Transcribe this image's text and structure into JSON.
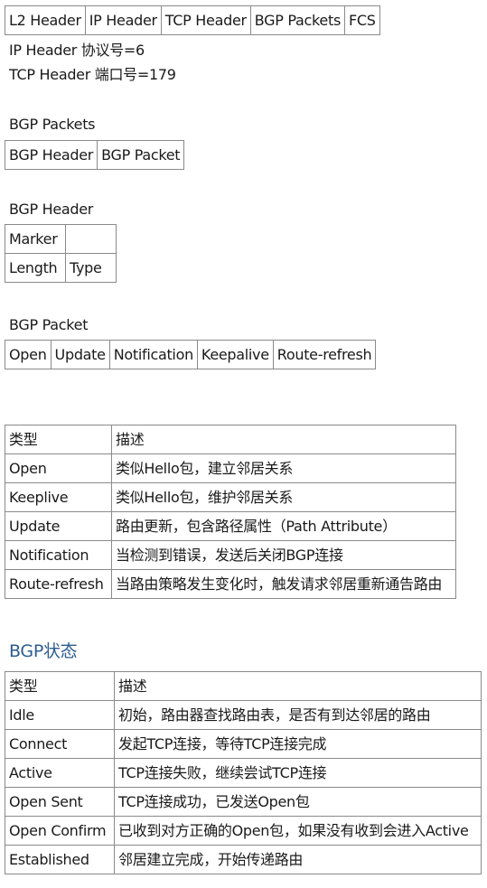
{
  "frame": {
    "cells": [
      "L2 Header",
      "IP Header",
      "TCP Header",
      "BGP Packets",
      "FCS"
    ]
  },
  "notes": {
    "ip_protocol": "IP Header 协议号=6",
    "tcp_port": "TCP Header 端口号=179"
  },
  "bgp_packets": {
    "heading": "BGP Packets",
    "cells": [
      "BGP Header",
      "BGP Packet"
    ]
  },
  "bgp_header": {
    "heading": "BGP Header",
    "rows": [
      [
        "Marker",
        ""
      ],
      [
        "Length",
        "Type"
      ]
    ]
  },
  "bgp_packet": {
    "heading": "BGP Packet",
    "cells": [
      "Open",
      "Update",
      "Notification",
      "Keepalive",
      "Route-refresh"
    ]
  },
  "message_types": {
    "headers": [
      "类型",
      "描述"
    ],
    "rows": [
      [
        "Open",
        "类似Hello包，建立邻居关系"
      ],
      [
        "Keeplive",
        "类似Hello包，维护邻居关系"
      ],
      [
        "Update",
        "路由更新，包含路径属性（Path Attribute）"
      ],
      [
        "Notification",
        "当检测到错误，发送后关闭BGP连接"
      ],
      [
        "Route-refresh",
        "当路由策略发生变化时，触发请求邻居重新通告路由"
      ]
    ]
  },
  "bgp_states": {
    "heading": "BGP状态",
    "heading_color": "#2e5d8f",
    "headers": [
      "类型",
      "描述"
    ],
    "rows": [
      [
        "Idle",
        "初始，路由器查找路由表，是否有到达邻居的路由"
      ],
      [
        "Connect",
        "发起TCP连接，等待TCP连接完成"
      ],
      [
        "Active",
        "TCP连接失败，继续尝试TCP连接"
      ],
      [
        "Open Sent",
        "TCP连接成功，已发送Open包"
      ],
      [
        "Open Confirm",
        "已收到对方正确的Open包，如果没有收到会进入Active"
      ],
      [
        "Established",
        "邻居建立完成，开始传递路由"
      ]
    ]
  }
}
